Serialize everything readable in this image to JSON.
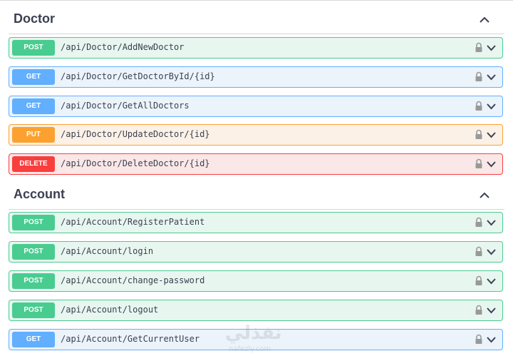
{
  "sections": [
    {
      "title": "Doctor",
      "operations": [
        {
          "method": "POST",
          "path": "/api/Doctor/AddNewDoctor"
        },
        {
          "method": "GET",
          "path": "/api/Doctor/GetDoctorById/{id}"
        },
        {
          "method": "GET",
          "path": "/api/Doctor/GetAllDoctors"
        },
        {
          "method": "PUT",
          "path": "/api/Doctor/UpdateDoctor/{id}"
        },
        {
          "method": "DELETE",
          "path": "/api/Doctor/DeleteDoctor/{id}"
        }
      ]
    },
    {
      "title": "Account",
      "operations": [
        {
          "method": "POST",
          "path": "/api/Account/RegisterPatient"
        },
        {
          "method": "POST",
          "path": "/api/Account/login"
        },
        {
          "method": "POST",
          "path": "/api/Account/change-password"
        },
        {
          "method": "POST",
          "path": "/api/Account/logout"
        },
        {
          "method": "GET",
          "path": "/api/Account/GetCurrentUser"
        }
      ]
    }
  ],
  "watermark": {
    "text": "نفذلي",
    "subtext": "nafezly.com"
  },
  "colors": {
    "post": "#49cc90",
    "get": "#61affe",
    "put": "#fca130",
    "delete": "#f93e3e"
  },
  "icons": {
    "collapse": "chevron-up-icon",
    "lock": "lock-icon",
    "expand": "chevron-down-icon"
  }
}
